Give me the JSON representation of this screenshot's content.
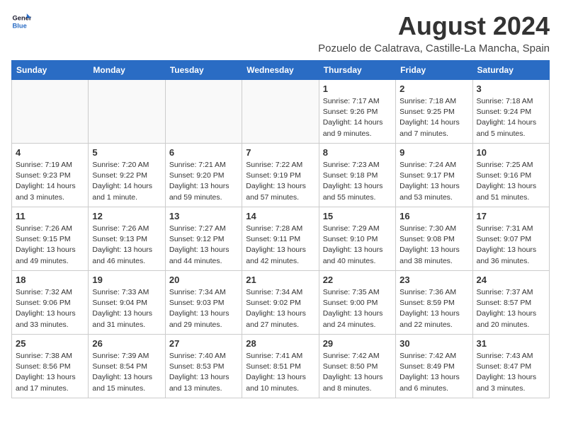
{
  "header": {
    "logo_line1": "General",
    "logo_line2": "Blue",
    "title": "August 2024",
    "subtitle": "Pozuelo de Calatrava, Castille-La Mancha, Spain"
  },
  "weekdays": [
    "Sunday",
    "Monday",
    "Tuesday",
    "Wednesday",
    "Thursday",
    "Friday",
    "Saturday"
  ],
  "weeks": [
    [
      {
        "day": "",
        "detail": ""
      },
      {
        "day": "",
        "detail": ""
      },
      {
        "day": "",
        "detail": ""
      },
      {
        "day": "",
        "detail": ""
      },
      {
        "day": "1",
        "detail": "Sunrise: 7:17 AM\nSunset: 9:26 PM\nDaylight: 14 hours and 9 minutes."
      },
      {
        "day": "2",
        "detail": "Sunrise: 7:18 AM\nSunset: 9:25 PM\nDaylight: 14 hours and 7 minutes."
      },
      {
        "day": "3",
        "detail": "Sunrise: 7:18 AM\nSunset: 9:24 PM\nDaylight: 14 hours and 5 minutes."
      }
    ],
    [
      {
        "day": "4",
        "detail": "Sunrise: 7:19 AM\nSunset: 9:23 PM\nDaylight: 14 hours and 3 minutes."
      },
      {
        "day": "5",
        "detail": "Sunrise: 7:20 AM\nSunset: 9:22 PM\nDaylight: 14 hours and 1 minute."
      },
      {
        "day": "6",
        "detail": "Sunrise: 7:21 AM\nSunset: 9:20 PM\nDaylight: 13 hours and 59 minutes."
      },
      {
        "day": "7",
        "detail": "Sunrise: 7:22 AM\nSunset: 9:19 PM\nDaylight: 13 hours and 57 minutes."
      },
      {
        "day": "8",
        "detail": "Sunrise: 7:23 AM\nSunset: 9:18 PM\nDaylight: 13 hours and 55 minutes."
      },
      {
        "day": "9",
        "detail": "Sunrise: 7:24 AM\nSunset: 9:17 PM\nDaylight: 13 hours and 53 minutes."
      },
      {
        "day": "10",
        "detail": "Sunrise: 7:25 AM\nSunset: 9:16 PM\nDaylight: 13 hours and 51 minutes."
      }
    ],
    [
      {
        "day": "11",
        "detail": "Sunrise: 7:26 AM\nSunset: 9:15 PM\nDaylight: 13 hours and 49 minutes."
      },
      {
        "day": "12",
        "detail": "Sunrise: 7:26 AM\nSunset: 9:13 PM\nDaylight: 13 hours and 46 minutes."
      },
      {
        "day": "13",
        "detail": "Sunrise: 7:27 AM\nSunset: 9:12 PM\nDaylight: 13 hours and 44 minutes."
      },
      {
        "day": "14",
        "detail": "Sunrise: 7:28 AM\nSunset: 9:11 PM\nDaylight: 13 hours and 42 minutes."
      },
      {
        "day": "15",
        "detail": "Sunrise: 7:29 AM\nSunset: 9:10 PM\nDaylight: 13 hours and 40 minutes."
      },
      {
        "day": "16",
        "detail": "Sunrise: 7:30 AM\nSunset: 9:08 PM\nDaylight: 13 hours and 38 minutes."
      },
      {
        "day": "17",
        "detail": "Sunrise: 7:31 AM\nSunset: 9:07 PM\nDaylight: 13 hours and 36 minutes."
      }
    ],
    [
      {
        "day": "18",
        "detail": "Sunrise: 7:32 AM\nSunset: 9:06 PM\nDaylight: 13 hours and 33 minutes."
      },
      {
        "day": "19",
        "detail": "Sunrise: 7:33 AM\nSunset: 9:04 PM\nDaylight: 13 hours and 31 minutes."
      },
      {
        "day": "20",
        "detail": "Sunrise: 7:34 AM\nSunset: 9:03 PM\nDaylight: 13 hours and 29 minutes."
      },
      {
        "day": "21",
        "detail": "Sunrise: 7:34 AM\nSunset: 9:02 PM\nDaylight: 13 hours and 27 minutes."
      },
      {
        "day": "22",
        "detail": "Sunrise: 7:35 AM\nSunset: 9:00 PM\nDaylight: 13 hours and 24 minutes."
      },
      {
        "day": "23",
        "detail": "Sunrise: 7:36 AM\nSunset: 8:59 PM\nDaylight: 13 hours and 22 minutes."
      },
      {
        "day": "24",
        "detail": "Sunrise: 7:37 AM\nSunset: 8:57 PM\nDaylight: 13 hours and 20 minutes."
      }
    ],
    [
      {
        "day": "25",
        "detail": "Sunrise: 7:38 AM\nSunset: 8:56 PM\nDaylight: 13 hours and 17 minutes."
      },
      {
        "day": "26",
        "detail": "Sunrise: 7:39 AM\nSunset: 8:54 PM\nDaylight: 13 hours and 15 minutes."
      },
      {
        "day": "27",
        "detail": "Sunrise: 7:40 AM\nSunset: 8:53 PM\nDaylight: 13 hours and 13 minutes."
      },
      {
        "day": "28",
        "detail": "Sunrise: 7:41 AM\nSunset: 8:51 PM\nDaylight: 13 hours and 10 minutes."
      },
      {
        "day": "29",
        "detail": "Sunrise: 7:42 AM\nSunset: 8:50 PM\nDaylight: 13 hours and 8 minutes."
      },
      {
        "day": "30",
        "detail": "Sunrise: 7:42 AM\nSunset: 8:49 PM\nDaylight: 13 hours and 6 minutes."
      },
      {
        "day": "31",
        "detail": "Sunrise: 7:43 AM\nSunset: 8:47 PM\nDaylight: 13 hours and 3 minutes."
      }
    ]
  ]
}
